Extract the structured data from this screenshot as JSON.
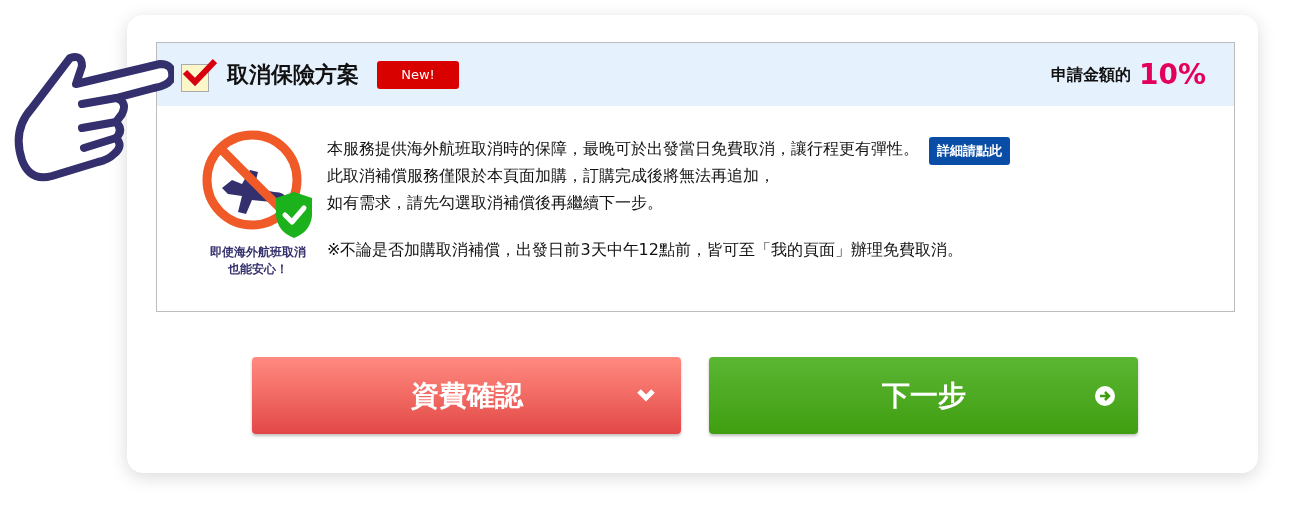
{
  "plan": {
    "checked": true,
    "title": "取消保險方案",
    "badge": "New!",
    "amount_label": "申請金額的",
    "amount_value": "10%"
  },
  "illustration": {
    "caption": [
      "即使海外航班取消",
      "也能安心！"
    ]
  },
  "description": {
    "lines": [
      "本服務提供海外航班取消時的保障，最晚可於出發當日免費取消，讓行程更有彈性。",
      "此取消補償服務僅限於本頁面加購，訂購完成後將無法再追加，",
      "如有需求，請先勾選取消補償後再繼續下一步。"
    ],
    "details_link": "詳細請點此",
    "note": "※不論是否加購取消補償，出發日前3天中午12點前，皆可至「我的頁面」辦理免費取消。"
  },
  "buttons": [
    {
      "kind": "dropdown",
      "label": "資費確認"
    },
    {
      "kind": "next",
      "label": "下一步"
    }
  ]
}
